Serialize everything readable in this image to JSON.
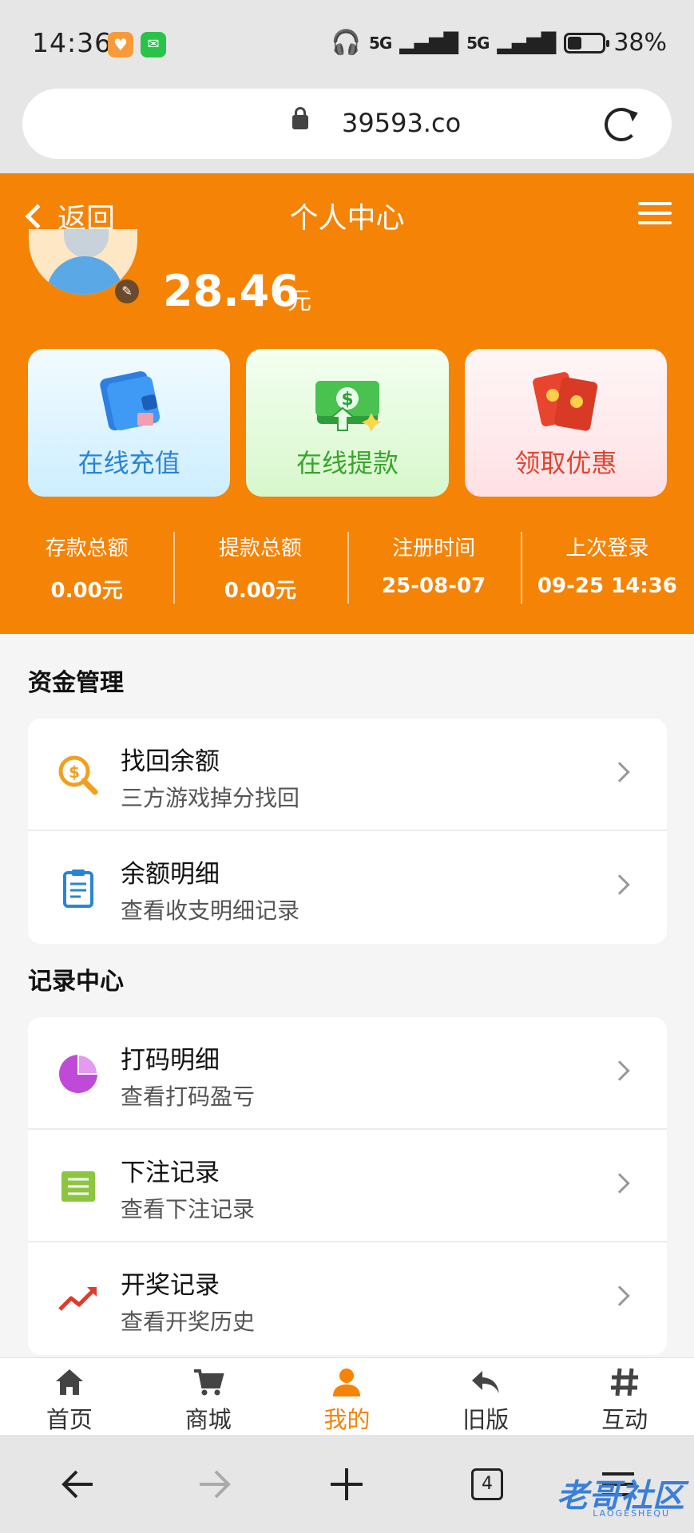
{
  "status_bar": {
    "time": "14:36",
    "signal1": "5G",
    "signal2": "5G",
    "battery": "38%",
    "battery_level": 0.38
  },
  "address_bar": {
    "url": "39593.co"
  },
  "header": {
    "back_label": "返回",
    "title": "个人中心"
  },
  "profile": {
    "balance": "28.46",
    "balance_unit": "元"
  },
  "actions": [
    {
      "label": "在线充值",
      "icon": "wallet-icon"
    },
    {
      "label": "在线提款",
      "icon": "cash-withdraw-icon"
    },
    {
      "label": "领取优惠",
      "icon": "red-envelope-icon"
    }
  ],
  "stats": [
    {
      "label": "存款总额",
      "value": "0.00元"
    },
    {
      "label": "提款总额",
      "value": "0.00元"
    },
    {
      "label": "注册时间",
      "value": "25-08-07"
    },
    {
      "label": "上次登录",
      "value": "09-25 14:36"
    }
  ],
  "sections": [
    {
      "title": "资金管理",
      "items": [
        {
          "title": "找回余额",
          "subtitle": "三方游戏掉分找回",
          "icon": "search-money-icon"
        },
        {
          "title": "余额明细",
          "subtitle": "查看收支明细记录",
          "icon": "clipboard-icon"
        }
      ]
    },
    {
      "title": "记录中心",
      "items": [
        {
          "title": "打码明细",
          "subtitle": "查看打码盈亏",
          "icon": "pie-chart-icon"
        },
        {
          "title": "下注记录",
          "subtitle": "查看下注记录",
          "icon": "list-icon"
        },
        {
          "title": "开奖记录",
          "subtitle": "查看开奖历史",
          "icon": "trend-icon"
        }
      ]
    }
  ],
  "tabbar": [
    {
      "label": "首页",
      "icon": "home-icon"
    },
    {
      "label": "商城",
      "icon": "cart-icon"
    },
    {
      "label": "我的",
      "icon": "user-icon",
      "active": true
    },
    {
      "label": "旧版",
      "icon": "reply-icon"
    },
    {
      "label": "互动",
      "icon": "hash-icon"
    }
  ],
  "browser": {
    "tab_count": "4"
  },
  "watermark": {
    "text": "老哥社区",
    "sub": "LAOGESHEQU"
  },
  "colors": {
    "brand": "#f58306",
    "active_tab": "#f58306"
  }
}
